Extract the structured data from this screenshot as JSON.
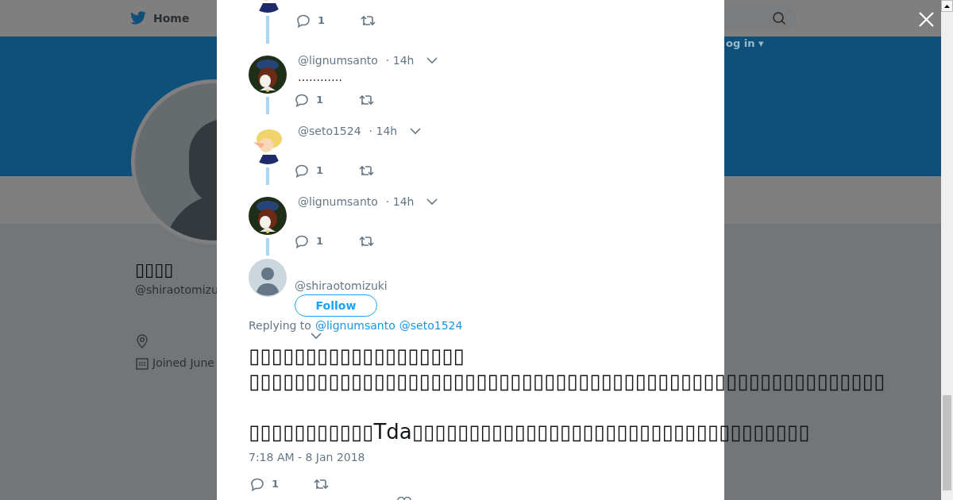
{
  "background_page": {
    "nav": {
      "home": "Home",
      "login": "og in ▾"
    },
    "profile": {
      "name": "▯▯▯▯",
      "handle": "@shiraotomizu",
      "joined": "Joined June"
    }
  },
  "thread": [
    {
      "kind": "cut",
      "reply_count": "1"
    },
    {
      "kind": "reply",
      "handle": "@lignumsanto",
      "time": "· 14h",
      "text": "…………",
      "reply_count": "1"
    },
    {
      "kind": "reply",
      "handle": "@seto1524",
      "time": "· 14h",
      "reply_count": "1"
    },
    {
      "kind": "reply",
      "handle": "@lignumsanto",
      "time": "· 14h",
      "reply_count": "1"
    }
  ],
  "main_tweet": {
    "handle": "@shiraotomizuki",
    "follow": "Follow",
    "replying_label": "Replying to",
    "replying_to": [
      "@lignumsanto",
      "@seto1524"
    ],
    "text": "▯▯▯▯▯▯▯▯▯▯▯▯▯▯▯▯▯▯▯\n▯▯▯▯▯▯▯▯▯▯▯▯▯▯▯▯▯▯▯▯▯▯▯▯▯▯▯▯▯▯▯▯▯▯▯▯▯▯▯▯▯▯▯▯▯▯▯▯▯▯▯▯▯▯▯▯\n\n▯▯▯▯▯▯▯▯▯▯▯Tda▯▯▯▯▯▯▯▯▯▯▯▯▯▯▯▯▯▯▯▯▯▯▯▯▯▯▯▯▯▯▯▯▯▯▯",
    "timestamp": "7:18 AM - 8 Jan 2018",
    "reply_count": "1"
  }
}
